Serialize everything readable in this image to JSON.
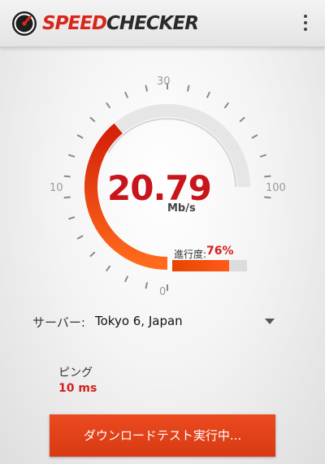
{
  "app": {
    "brand_part1": "SPEED",
    "brand_part2": "CHECKER",
    "logo_icon": "speedometer-icon",
    "menu_icon": "more-vert-icon",
    "brand_color": "#d8261a"
  },
  "gauge": {
    "tick_labels": {
      "top": "30",
      "left": "10",
      "right": "100",
      "bottom": "0"
    },
    "speed": "20.79",
    "unit": "Mb/s",
    "progress_label": "進行度:",
    "progress_text": "76%",
    "progress_fraction": 0.76,
    "arc_color": "#e03a0c"
  },
  "server": {
    "label": "サーバー:",
    "value": "Tokyo 6, Japan",
    "dropdown_icon": "arrow-drop-down-icon"
  },
  "ping": {
    "label": "ピング",
    "value": "10 ms"
  },
  "action": {
    "label": "ダウンロードテスト実行中..."
  }
}
